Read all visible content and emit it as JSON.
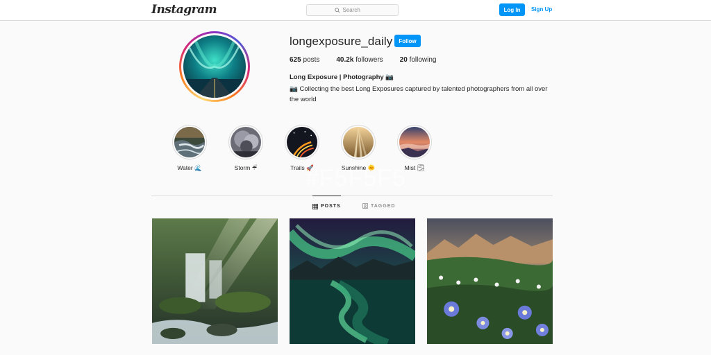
{
  "topbar": {
    "logo": "Instagram",
    "search_placeholder": "Search",
    "login_label": "Log In",
    "signup_label": "Sign Up"
  },
  "profile": {
    "username": "longexposure_daily",
    "follow_label": "Follow",
    "stats": {
      "posts_count": "625",
      "posts_label": "posts",
      "followers_count": "40.2k",
      "followers_label": "followers",
      "following_count": "20",
      "following_label": "following"
    },
    "bio_name": "Long Exposure | Photography 📷",
    "bio_text": "📷 Collecting the best Long Exposures captured by talented photographers from all over the world"
  },
  "highlights": [
    {
      "label": "Water 🌊"
    },
    {
      "label": "Storm ☔"
    },
    {
      "label": "Trails 🚀"
    },
    {
      "label": "Sunshine 🌞"
    },
    {
      "label": "Mist 🌫"
    }
  ],
  "watermark": "#F5F5F5",
  "tabs": {
    "posts_label": "POSTS",
    "tagged_label": "TAGGED",
    "active": "posts"
  },
  "posts": [
    {
      "subject": "waterfall in forest"
    },
    {
      "subject": "aurora over lake"
    },
    {
      "subject": "wildflowers in mountain valley"
    }
  ],
  "colors": {
    "accent": "#0095f6",
    "text": "#262626",
    "muted": "#8e8e8e",
    "background": "#fafafa",
    "border": "#dbdbdb"
  }
}
